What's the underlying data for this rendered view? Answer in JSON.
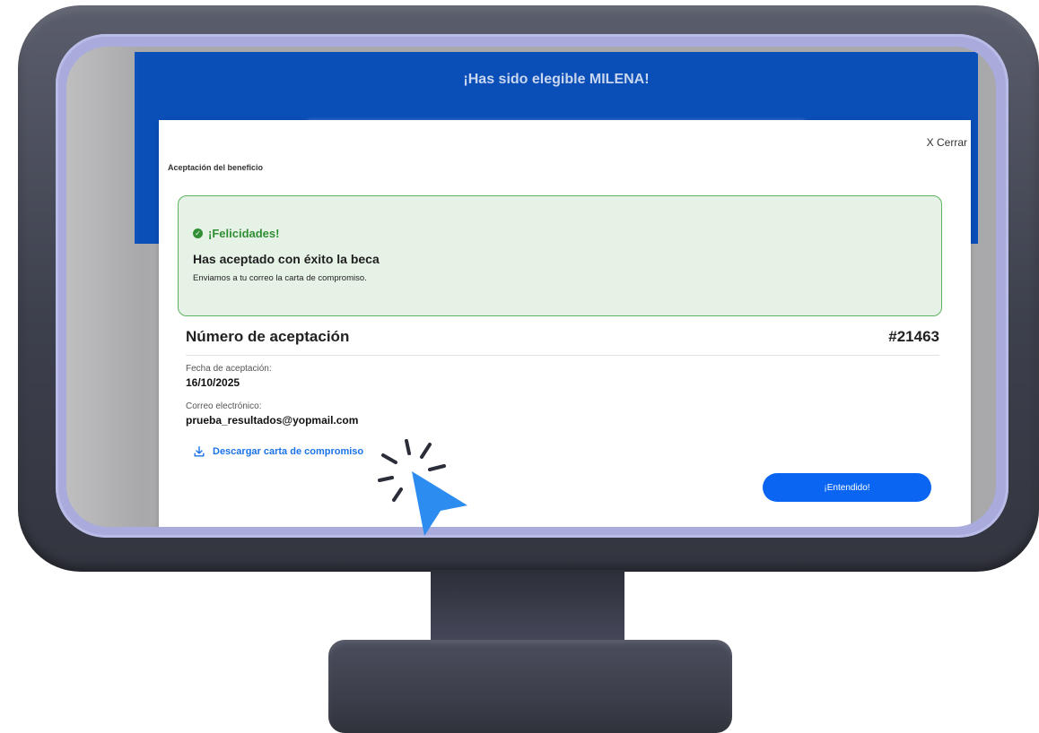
{
  "page_header": {
    "title": "¡Has sido elegible MILENA!"
  },
  "modal": {
    "close_label": "X Cerrar",
    "title": "Aceptación del beneficio",
    "success": {
      "heading": "¡Felicidades!",
      "title": "Has aceptado con éxito la beca",
      "message": "Enviamos a tu correo la carta de compromiso."
    },
    "acceptance": {
      "label": "Número de aceptación",
      "number": "#21463"
    },
    "date": {
      "label": "Fecha de aceptación:",
      "value": "16/10/2025"
    },
    "email": {
      "label": "Correo electrónico:",
      "value": "prueba_resultados@yopmail.com"
    },
    "download_label": "Descargar carta de compromiso",
    "confirm_label": "¡Entendido!"
  },
  "colors": {
    "header_blue": "#0a4fb8",
    "success_green": "#2f8f33",
    "link_blue": "#1a73e8",
    "button_blue": "#0a66f2",
    "cursor_blue": "#2d8cf0",
    "monitor_dark": "#3d404d"
  },
  "icons": {
    "success": "check-circle-icon",
    "download": "download-icon",
    "cursor": "pointer-cursor-icon"
  }
}
